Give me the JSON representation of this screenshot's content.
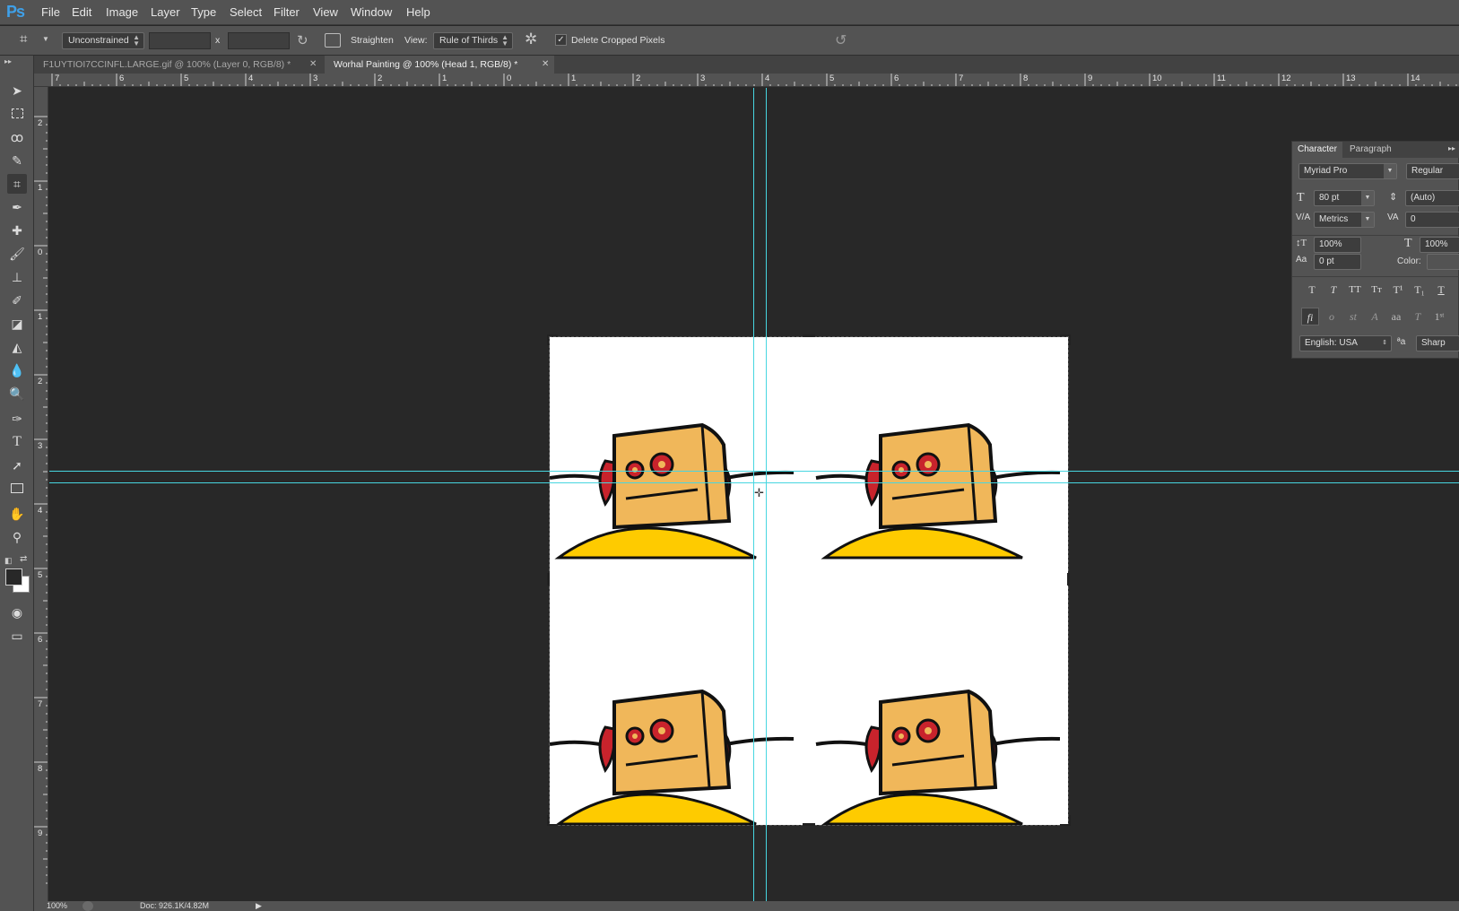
{
  "app": {
    "logo": "Ps"
  },
  "menu": [
    "File",
    "Edit",
    "Image",
    "Layer",
    "Type",
    "Select",
    "Filter",
    "View",
    "Window",
    "Help"
  ],
  "options": {
    "ratio_preset": "Unconstrained",
    "ratio_x": "x",
    "straighten_label": "Straighten",
    "view_label": "View:",
    "view_value": "Rule of Thirds",
    "delete_cropped_label": "Delete Cropped Pixels",
    "delete_cropped_checked": true
  },
  "tabs": [
    {
      "label": "F1UYTIOI7CCINFL.LARGE.gif @ 100% (Layer 0, RGB/8) *",
      "active": false
    },
    {
      "label": "Worhal Painting @ 100% (Head 1, RGB/8) *",
      "active": true
    }
  ],
  "ruler": {
    "horizontal": [
      "7",
      "6",
      "5",
      "4",
      "3",
      "2",
      "1",
      "0",
      "1",
      "2",
      "3",
      "4",
      "5",
      "6",
      "7",
      "8",
      "9",
      "10",
      "11",
      "12",
      "13",
      "14"
    ],
    "vertical": [
      "2",
      "1",
      "0",
      "1",
      "2",
      "3",
      "4",
      "5",
      "6",
      "7",
      "8",
      "9"
    ]
  },
  "character_panel": {
    "tabs": [
      "Character",
      "Paragraph"
    ],
    "font_family": "Myriad Pro",
    "font_style": "Regular",
    "font_size": "80 pt",
    "leading": "(Auto)",
    "kerning": "Metrics",
    "tracking": "0",
    "vertical_scale": "100%",
    "horizontal_scale": "100%",
    "baseline_shift": "0 pt",
    "color_label": "Color:",
    "language": "English: USA",
    "antialias_symbol": "a",
    "antialias": "Sharp"
  },
  "status": {
    "zoom": "100%",
    "doc_info": "Doc: 926.1K/4.82M"
  },
  "colors": {
    "guide": "#47d6e0",
    "robot_head": "#f0b75a",
    "robot_body": "#fecb00",
    "robot_ear": "#c8232c",
    "canvas_bg": "#282828"
  }
}
